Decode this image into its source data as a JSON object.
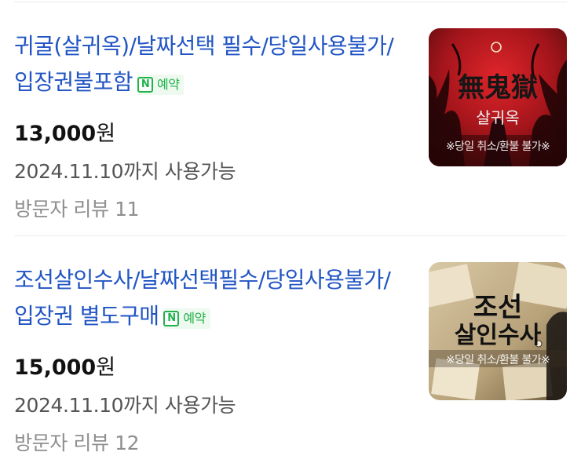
{
  "items": [
    {
      "title": "귀굴(살귀옥)/날짜선택 필수/당일사용불가/입장권불포함",
      "badge": {
        "icon": "N",
        "label": "예약"
      },
      "price_number": "13,000",
      "price_unit": "원",
      "valid": "2024.11.10까지 사용가능",
      "review": "방문자 리뷰 11",
      "thumb": {
        "logo": "無鬼獄",
        "subtitle": "살귀옥",
        "notice": "※당일 취소/환불 불가※"
      }
    },
    {
      "title": "조선살인수사/날짜선택필수/당일사용불가/입장권 별도구매",
      "badge": {
        "icon": "N",
        "label": "예약"
      },
      "price_number": "15,000",
      "price_unit": "원",
      "valid": "2024.11.10까지 사용가능",
      "review": "방문자 리뷰 12",
      "thumb": {
        "logo_line1": "조선",
        "logo_line2": "살인수사",
        "notice": "※당일 취소/환불 불가※"
      }
    }
  ],
  "colors": {
    "title": "#2155c4",
    "badge_green": "#20b34a",
    "price": "#111111",
    "valid": "#555555",
    "review": "#8e8e8e"
  }
}
